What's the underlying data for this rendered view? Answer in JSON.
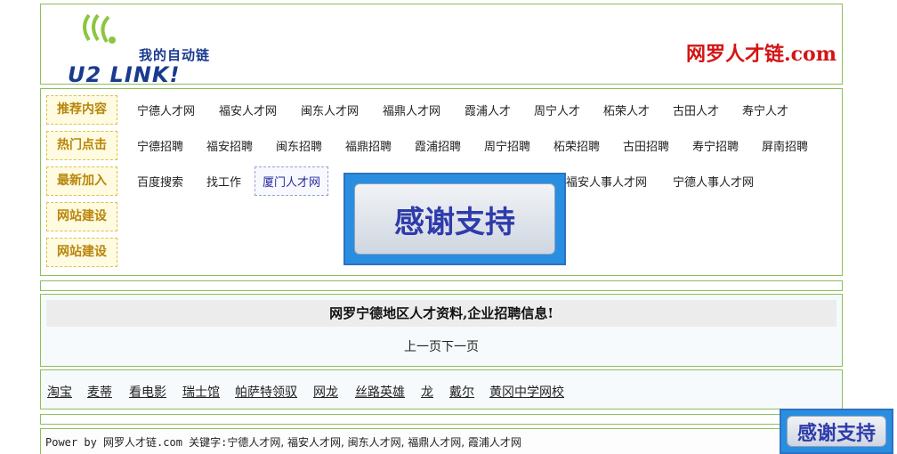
{
  "header": {
    "logo_cn": "我的自动链",
    "logo_en": "U2 LINK!",
    "site_title": "网罗人才链.com"
  },
  "nav": {
    "tags": [
      "推荐内容",
      "热门点击",
      "最新加入",
      "网站建设",
      "网站建设"
    ],
    "row1": [
      "宁德人才网",
      "福安人才网",
      "闽东人才网",
      "福鼎人才网",
      "霞浦人才",
      "周宁人才",
      "柘荣人才",
      "古田人才",
      "寿宁人才"
    ],
    "row2": [
      "宁德招聘",
      "福安招聘",
      "闽东招聘",
      "福鼎招聘",
      "霞浦招聘",
      "周宁招聘",
      "柘荣招聘",
      "古田招聘",
      "寿宁招聘",
      "屏南招聘"
    ],
    "row3": [
      "百度搜索",
      "找工作",
      "厦门人才网",
      "福安人事人才网",
      "宁德人事人才网"
    ]
  },
  "banner": {
    "text": "感谢支持"
  },
  "info": {
    "title": "网罗宁德地区人才资料,企业招聘信息!",
    "pager": "上一页下一页"
  },
  "friends": [
    "淘宝",
    "麦蒂",
    "看电影",
    "瑞士馆",
    "帕萨特领驭",
    "网龙",
    "丝路英雄",
    "龙",
    "戴尔",
    "黄冈中学网校"
  ],
  "footer": {
    "prefix": "Power by 网罗人才链.com 关键字:",
    "keywords": "宁德人才网, 福安人才网, 闽东人才网, 福鼎人才网, 霞浦人才网"
  },
  "colors": {
    "border": "#8dbf5a",
    "brand_red": "#d41414",
    "tag_text": "#b8860b",
    "banner_blue": "#2a8ee0"
  }
}
